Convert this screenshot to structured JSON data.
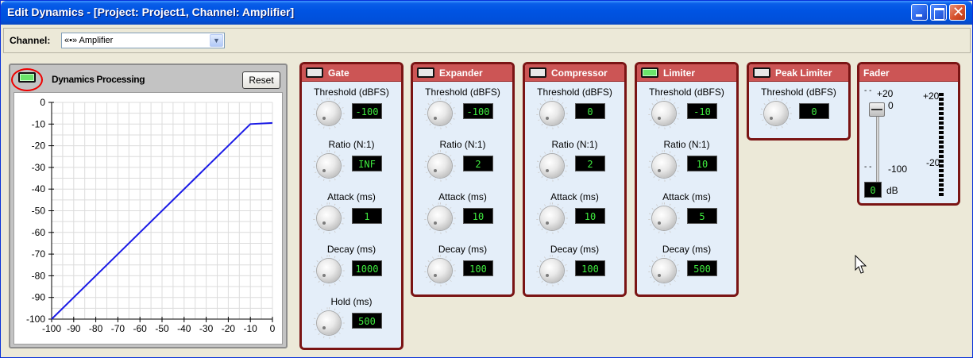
{
  "window": {
    "title": "Edit Dynamics - [Project: Project1, Channel: Amplifier]"
  },
  "channel": {
    "label": "Channel:",
    "value": "«•» Amplifier"
  },
  "graph": {
    "title": "Dynamics Processing",
    "reset_label": "Reset",
    "led_on": true,
    "y_ticks": [
      "0",
      "-10",
      "-20",
      "-30",
      "-40",
      "-50",
      "-60",
      "-70",
      "-80",
      "-90",
      "-100"
    ],
    "x_ticks": [
      "-100",
      "-90",
      "-80",
      "-70",
      "-60",
      "-50",
      "-40",
      "-30",
      "-20",
      "-10",
      "0"
    ],
    "curve": [
      [
        -100,
        -100
      ],
      [
        -10,
        -10
      ],
      [
        0,
        -9.5
      ]
    ],
    "line_color": "#1A1AE6"
  },
  "panels": [
    {
      "name": "Gate",
      "led_on": false,
      "params": [
        {
          "label": "Threshold (dBFS)",
          "value": "-100"
        },
        {
          "label": "Ratio (N:1)",
          "value": "INF"
        },
        {
          "label": "Attack (ms)",
          "value": "1"
        },
        {
          "label": "Decay (ms)",
          "value": "1000"
        },
        {
          "label": "Hold (ms)",
          "value": "500"
        }
      ]
    },
    {
      "name": "Expander",
      "led_on": false,
      "params": [
        {
          "label": "Threshold (dBFS)",
          "value": "-100"
        },
        {
          "label": "Ratio (N:1)",
          "value": "2"
        },
        {
          "label": "Attack (ms)",
          "value": "10"
        },
        {
          "label": "Decay (ms)",
          "value": "100"
        }
      ]
    },
    {
      "name": "Compressor",
      "led_on": false,
      "params": [
        {
          "label": "Threshold (dBFS)",
          "value": "0"
        },
        {
          "label": "Ratio (N:1)",
          "value": "2"
        },
        {
          "label": "Attack (ms)",
          "value": "10"
        },
        {
          "label": "Decay (ms)",
          "value": "100"
        }
      ]
    },
    {
      "name": "Limiter",
      "led_on": true,
      "params": [
        {
          "label": "Threshold (dBFS)",
          "value": "-10"
        },
        {
          "label": "Ratio (N:1)",
          "value": "10"
        },
        {
          "label": "Attack (ms)",
          "value": "5"
        },
        {
          "label": "Decay (ms)",
          "value": "500"
        }
      ]
    },
    {
      "name": "Peak Limiter",
      "led_on": false,
      "params": [
        {
          "label": "Threshold (dBFS)",
          "value": "0"
        }
      ]
    }
  ],
  "fader": {
    "name": "Fader",
    "scale_top": "+20",
    "scale_zero": "0",
    "scale_bottom": "-100",
    "meter_top": "+20",
    "meter_bottom": "-20",
    "value": "0",
    "unit": "dB"
  }
}
